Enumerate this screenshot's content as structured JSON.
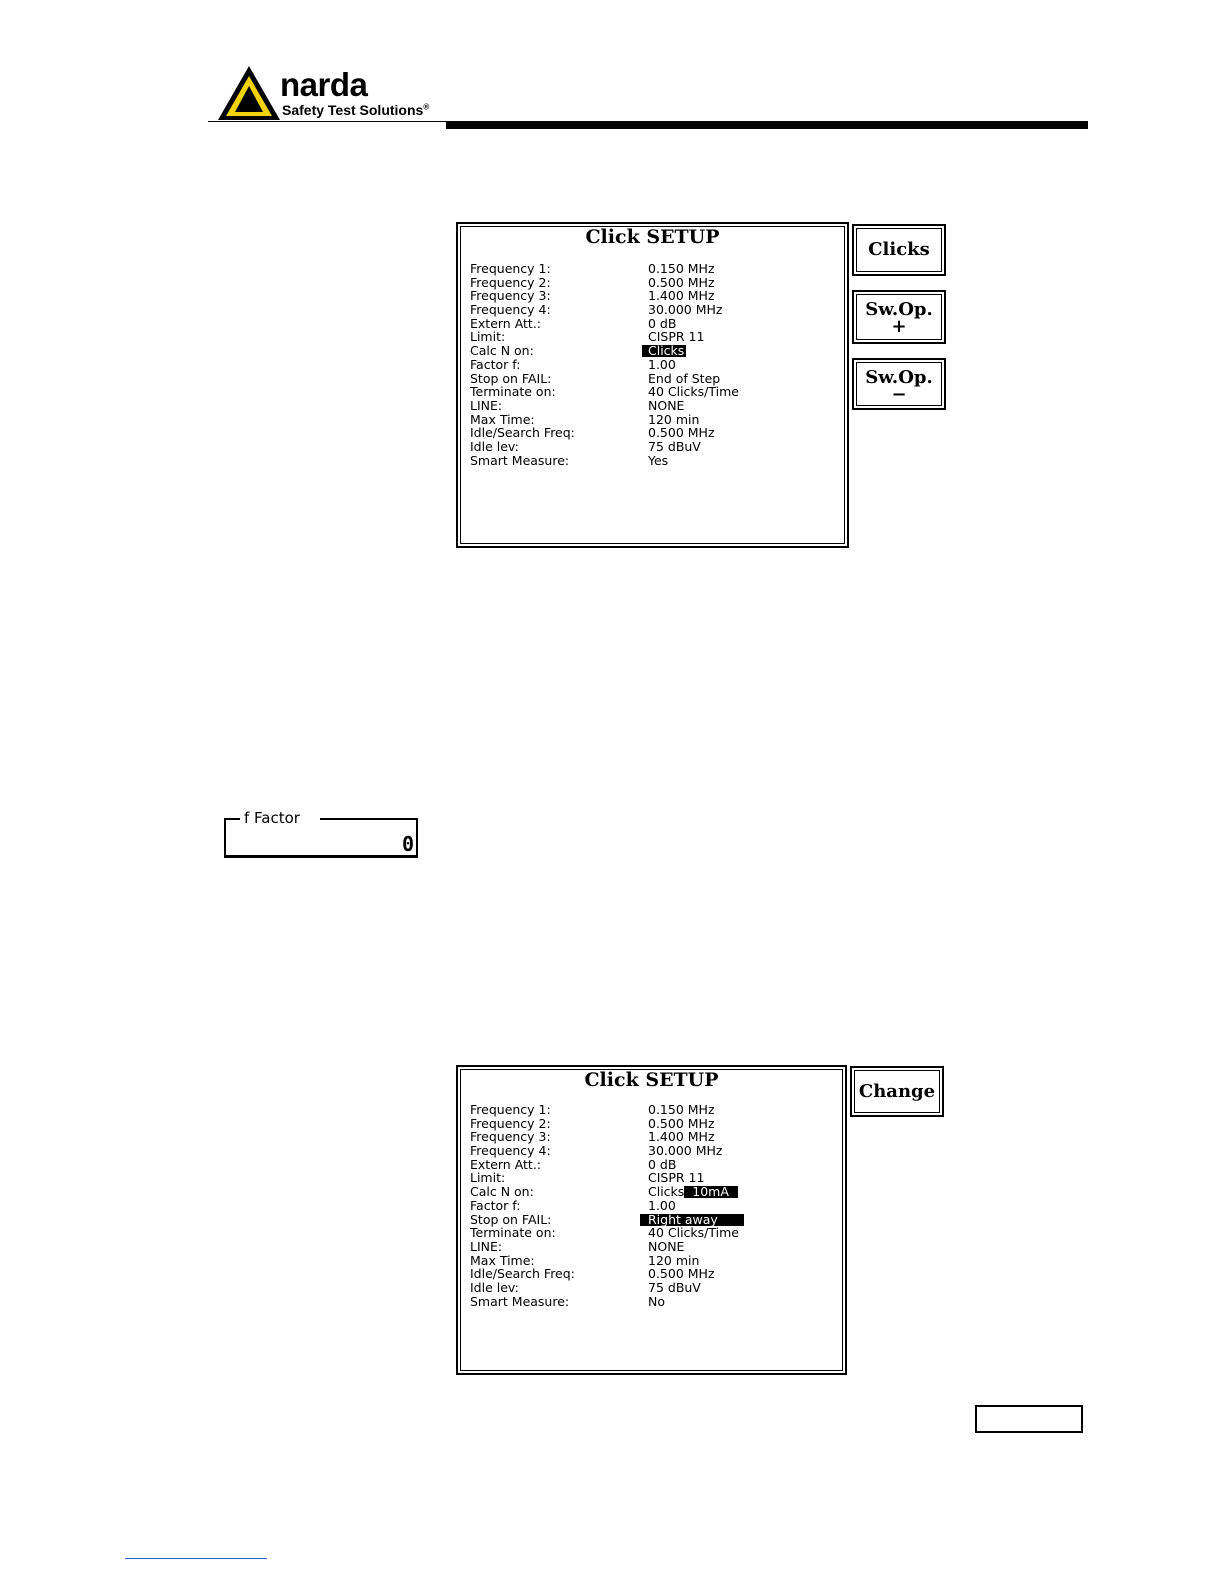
{
  "header": {
    "brand": "narda",
    "tagline": "Safety Test Solutions",
    "registered_mark": "®",
    "colors": {
      "triangle_fill": "#f2d20a",
      "rule": "#000000"
    }
  },
  "screen1": {
    "title": "Click SETUP",
    "rows": [
      {
        "label": "Frequency 1:",
        "value": "0.150  MHz"
      },
      {
        "label": "Frequency 2:",
        "value": "0.500  MHz"
      },
      {
        "label": "Frequency 3:",
        "value": "1.400  MHz"
      },
      {
        "label": "Frequency 4:",
        "value": "30.000  MHz"
      },
      {
        "label": "Extern Att.:",
        "value": "0  dB"
      },
      {
        "label": "Limit:",
        "value": "CISPR  11"
      },
      {
        "label": "Calc N on:",
        "value": "Clicks"
      },
      {
        "label": "Factor f:",
        "value": "1.00"
      },
      {
        "label": "Stop on FAIL:",
        "value": "End  of  Step"
      },
      {
        "label": "Terminate on:",
        "value": "40  Clicks/Time"
      },
      {
        "label": "LINE:",
        "value": "NONE"
      },
      {
        "label": "Max Time:",
        "value": "120  min"
      },
      {
        "label": "Idle/Search Freq:",
        "value": "0.500  MHz"
      },
      {
        "label": "Idle lev:",
        "value": "75  dBuV"
      },
      {
        "label": "Smart Measure:",
        "value": "Yes"
      }
    ],
    "softkeys": [
      {
        "line1": "Clicks",
        "line2": ""
      },
      {
        "line1": "Sw.Op.",
        "line2": "+"
      },
      {
        "line1": "Sw.Op.",
        "line2": "−"
      }
    ]
  },
  "f_factor": {
    "label": "f Factor",
    "value": "0"
  },
  "screen2": {
    "title": "Click SETUP",
    "rows": [
      {
        "label": "Frequency 1:",
        "value": "0.150  MHz"
      },
      {
        "label": "Frequency 2:",
        "value": "0.500  MHz"
      },
      {
        "label": "Frequency 3:",
        "value": "1.400  MHz"
      },
      {
        "label": "Frequency 4:",
        "value": "30.000  MHz"
      },
      {
        "label": "Extern Att.:",
        "value": "0  dB"
      },
      {
        "label": "Limit:",
        "value": "CISPR  11"
      },
      {
        "label": "Calc N on:",
        "value_prefix": "Clicks",
        "value_highlight": "  10mA"
      },
      {
        "label": "Factor f:",
        "value": "1.00"
      },
      {
        "label": "Stop on FAIL:",
        "value_highlight": "Right  away"
      },
      {
        "label": "Terminate on:",
        "value": "40  Clicks/Time"
      },
      {
        "label": "LINE:",
        "value": "NONE"
      },
      {
        "label": "Max Time:",
        "value": "120  min"
      },
      {
        "label": "Idle/Search Freq:",
        "value": "0.500  MHz"
      },
      {
        "label": "Idle lev:",
        "value": "75  dBuV"
      },
      {
        "label": "Smart Measure:",
        "value": "No"
      }
    ],
    "softkeys": [
      {
        "line1": "Change"
      }
    ]
  }
}
